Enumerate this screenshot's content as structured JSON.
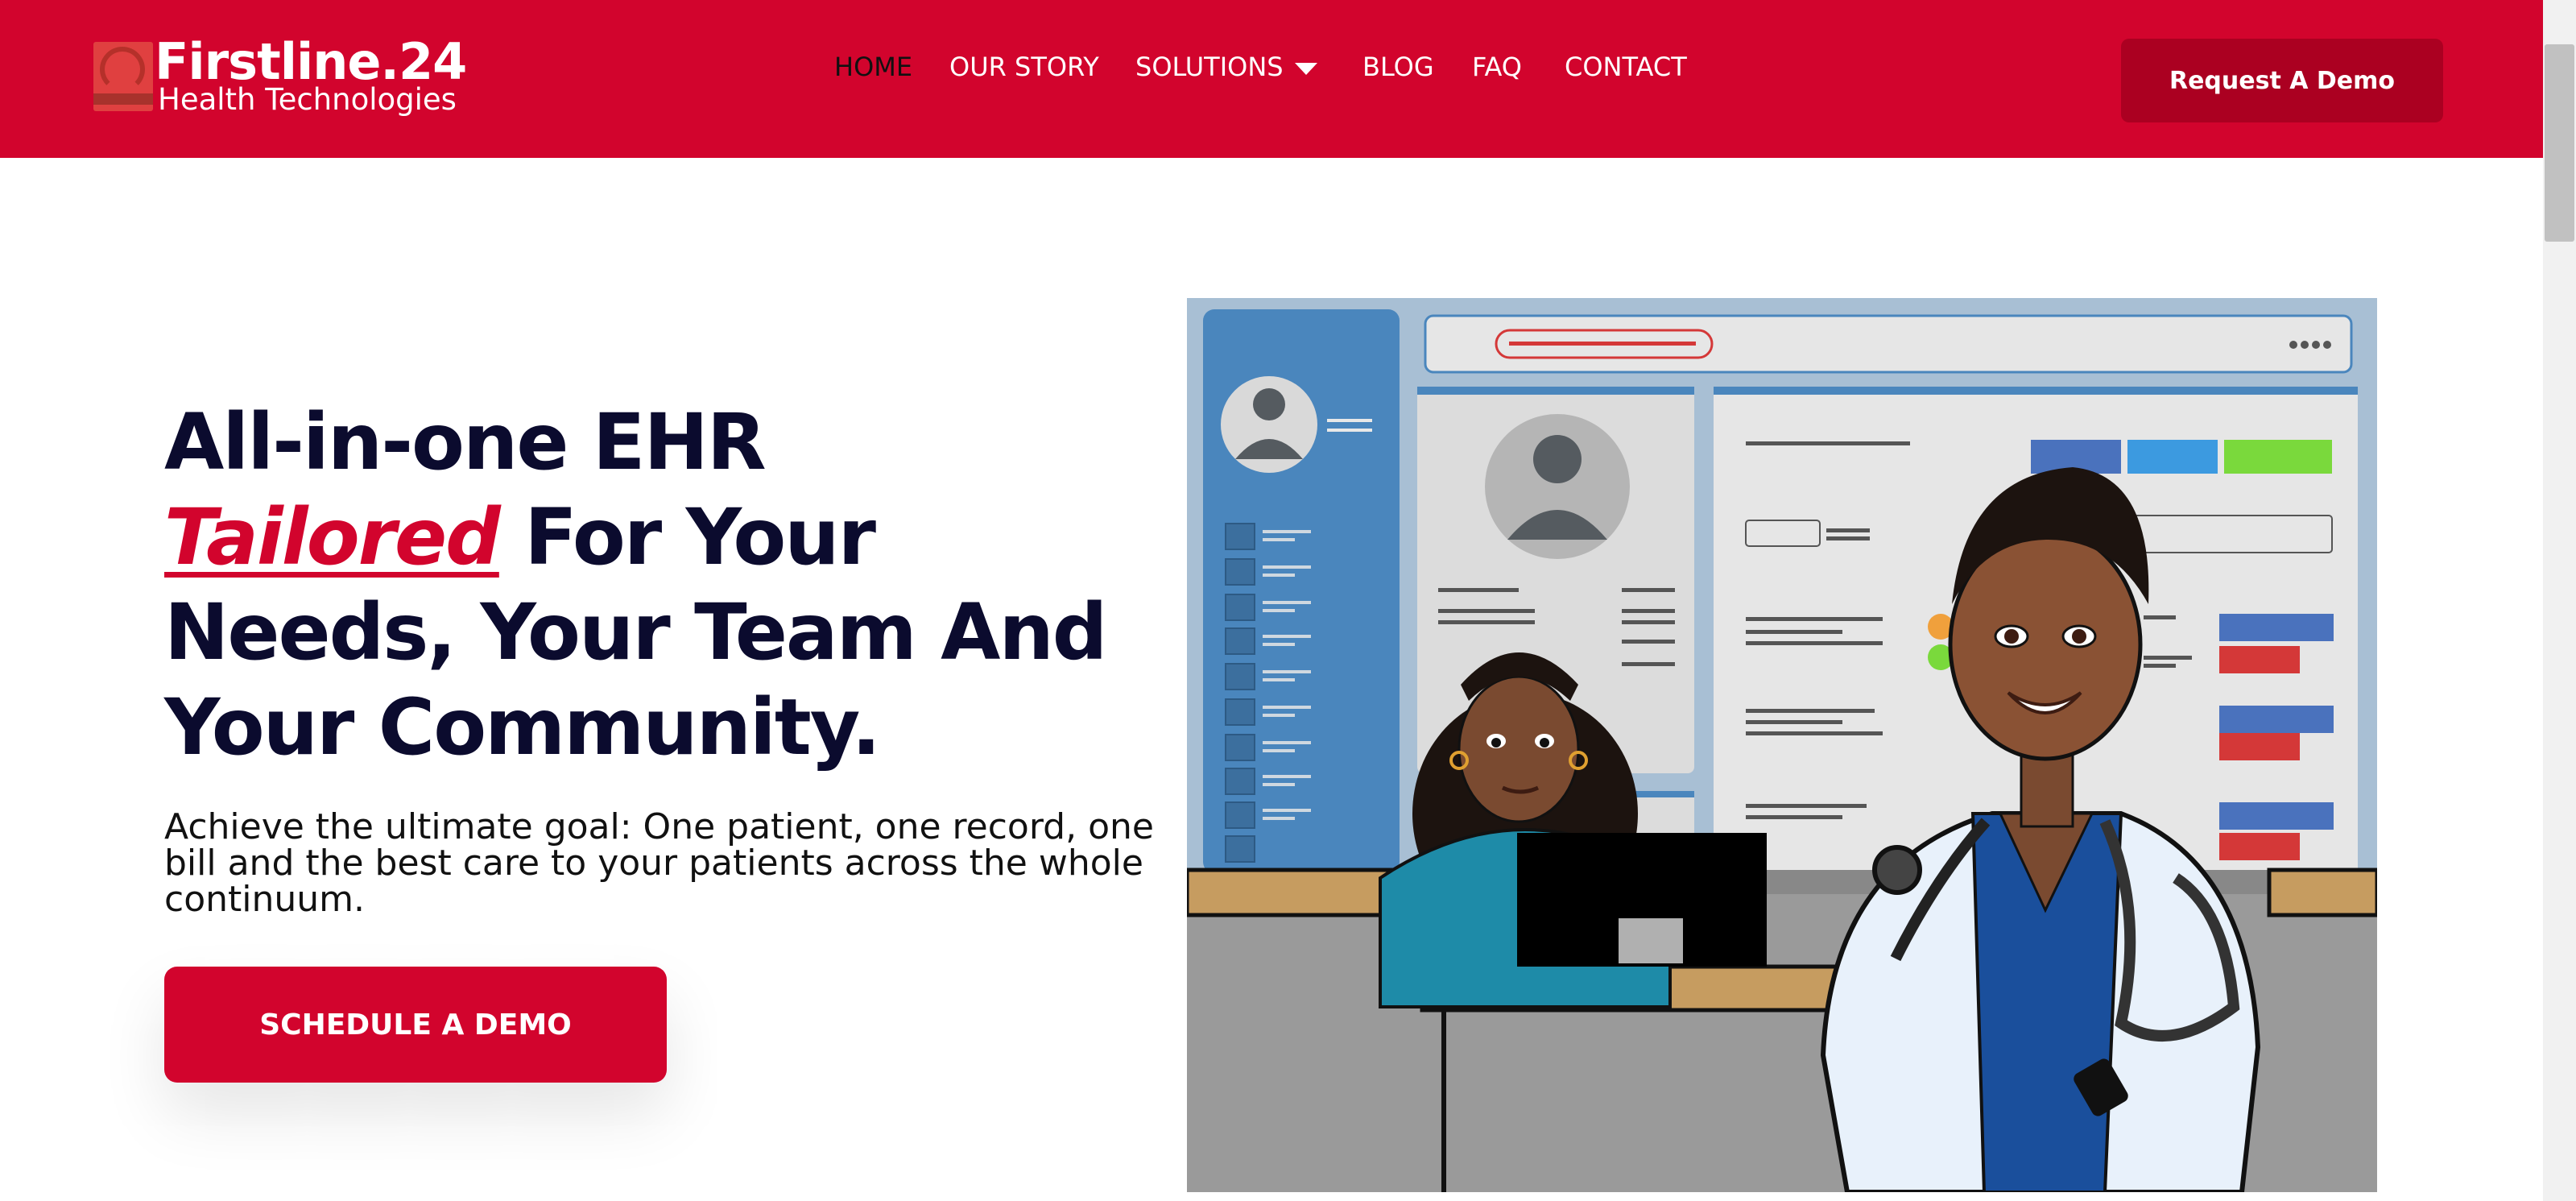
{
  "brand": {
    "title": "Firstline.24",
    "subtitle": "Health Technologies"
  },
  "nav": {
    "items": [
      {
        "label": "HOME",
        "active": true
      },
      {
        "label": "OUR STORY"
      },
      {
        "label": "SOLUTIONS",
        "has_dropdown": true
      },
      {
        "label": "BLOG"
      },
      {
        "label": "FAQ"
      },
      {
        "label": "CONTACT"
      }
    ],
    "demo_button": "Request A Demo"
  },
  "hero": {
    "headline_line1": "All-in-one EHR",
    "headline_accent": "Tailored",
    "headline_rest1": " For Your",
    "headline_line3": "Needs, Your Team And",
    "headline_line4": "Your Community.",
    "subtext": "Achieve the ultimate goal: One patient, one record, one bill and the best care to your  patients across the whole continuum.",
    "cta": "SCHEDULE A DEMO"
  },
  "colors": {
    "brand_red": "#d2042d",
    "button_dark_red": "#ab0021",
    "headline": "#0b0b2e"
  }
}
